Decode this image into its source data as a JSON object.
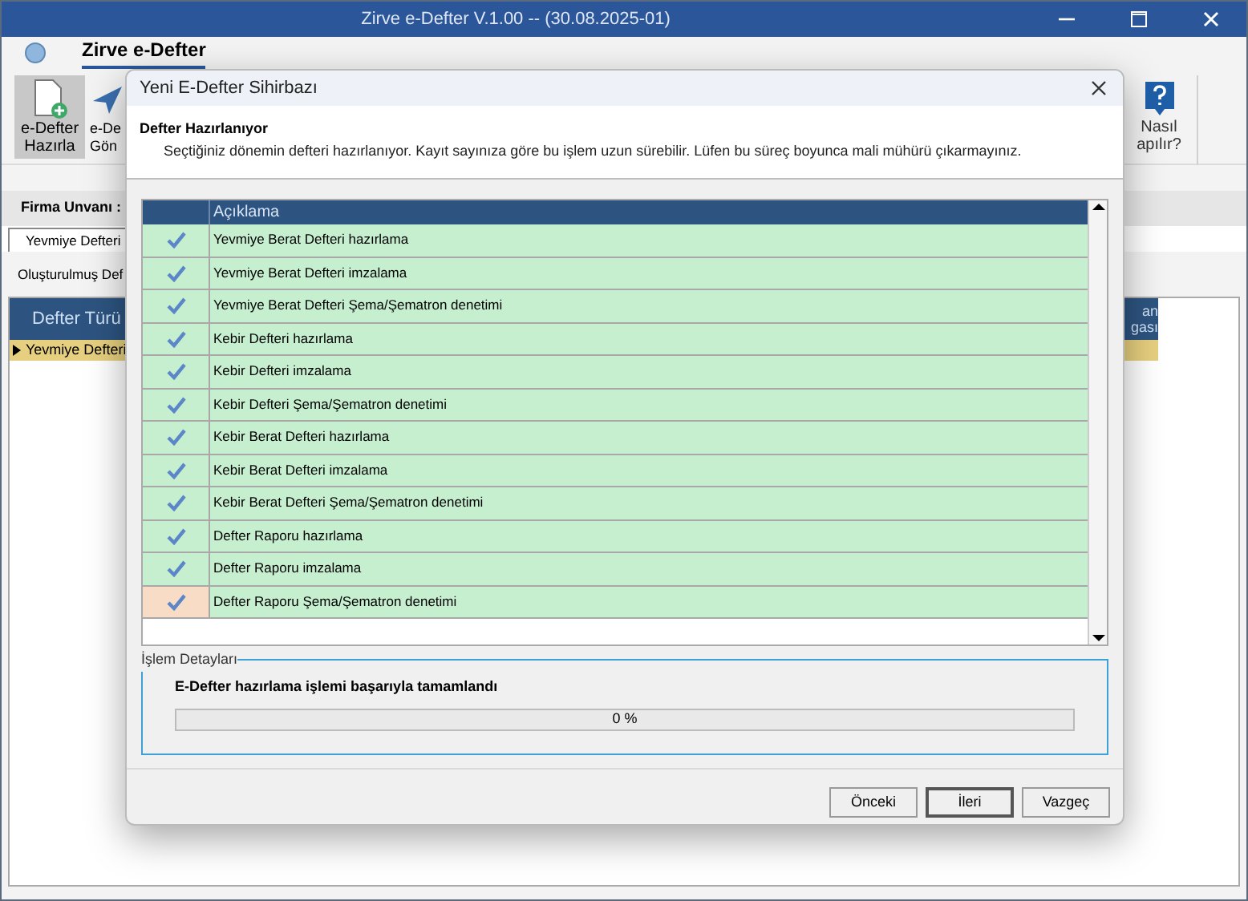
{
  "window": {
    "title": "Zirve e-Defter V.1.00  -- (30.08.2025-01)"
  },
  "ribbon": {
    "tab": "Zirve e-Defter",
    "buttons": [
      {
        "lines": [
          "e-Defter",
          "Hazırla"
        ],
        "selected": true
      },
      {
        "lines": [
          "e-De",
          "Gön"
        ],
        "selected": false
      }
    ],
    "help": {
      "lines": [
        "Nasıl",
        "apılır?"
      ]
    }
  },
  "firma_label": "Firma Unvanı :",
  "tabs": [
    {
      "label": "Yevmiye Defteri",
      "selected": true
    }
  ],
  "sub_label": "Oluşturulmuş Def",
  "table": {
    "columns": [
      "Defter Türü"
    ],
    "right_column": [
      "an",
      "gası"
    ],
    "rows": [
      {
        "cells": [
          "Yevmiye Defteri"
        ],
        "selected": true
      }
    ]
  },
  "dialog": {
    "title": "Yeni E-Defter Sihirbazı",
    "heading": "Defter Hazırlanıyor",
    "subtitle": "Seçtiğiniz dönemin defteri hazırlanıyor. Kayıt sayınıza göre bu işlem uzun sürebilir. Lüfen bu süreç boyunca mali mühürü çıkarmayınız.",
    "grid": {
      "column": "Açıklama",
      "rows": [
        {
          "text": "Yevmiye Berat Defteri hazırlama",
          "checked": true,
          "selected": false
        },
        {
          "text": "Yevmiye Berat Defteri imzalama",
          "checked": true,
          "selected": false
        },
        {
          "text": "Yevmiye Berat Defteri Şema/Şematron denetimi",
          "checked": true,
          "selected": false
        },
        {
          "text": "Kebir Defteri hazırlama",
          "checked": true,
          "selected": false
        },
        {
          "text": "Kebir Defteri imzalama",
          "checked": true,
          "selected": false
        },
        {
          "text": "Kebir Defteri Şema/Şematron denetimi",
          "checked": true,
          "selected": false
        },
        {
          "text": "Kebir Berat Defteri hazırlama",
          "checked": true,
          "selected": false
        },
        {
          "text": "Kebir Berat Defteri imzalama",
          "checked": true,
          "selected": false
        },
        {
          "text": "Kebir Berat Defteri Şema/Şematron denetimi",
          "checked": true,
          "selected": false
        },
        {
          "text": "Defter Raporu hazırlama",
          "checked": true,
          "selected": false
        },
        {
          "text": "Defter Raporu imzalama",
          "checked": true,
          "selected": false
        },
        {
          "text": "Defter Raporu Şema/Şematron denetimi",
          "checked": true,
          "selected": true
        }
      ]
    },
    "details": {
      "legend": "İşlem Detayları",
      "message": "E-Defter hazırlama işlemi başarıyla tamamlandı",
      "progress": {
        "level": 0,
        "reading": "0 %"
      }
    },
    "buttons": [
      {
        "label": "Önceki",
        "default": false
      },
      {
        "label": "İleri",
        "default": true
      },
      {
        "label": "Vazgeç",
        "default": false
      }
    ]
  }
}
